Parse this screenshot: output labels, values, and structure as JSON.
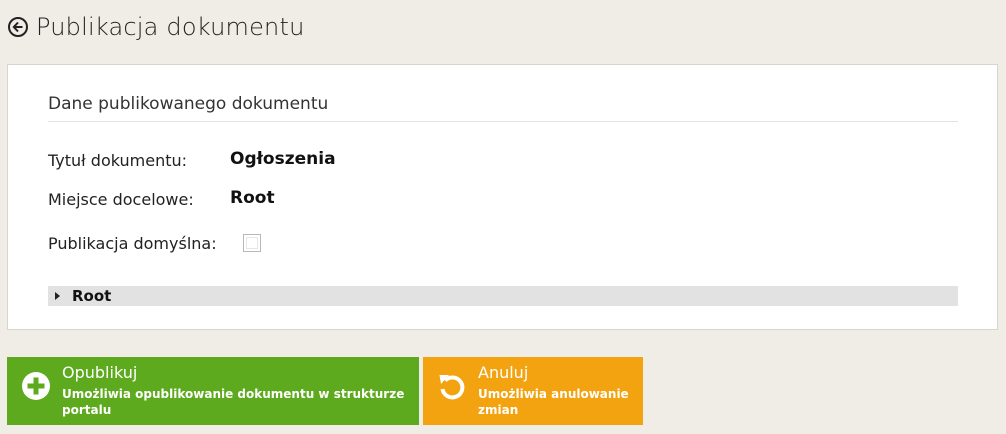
{
  "header": {
    "title": "Publikacja dokumentu",
    "back_icon": "arrow-left-circle-icon"
  },
  "panel": {
    "section_title": "Dane publikowanego dokumentu",
    "rows": [
      {
        "label": "Tytuł dokumentu:",
        "value": "Ogłoszenia"
      },
      {
        "label": "Miejsce docelowe:",
        "value": "Root"
      }
    ],
    "default_publication": {
      "label": "Publikacja domyślna:",
      "checked": false
    },
    "tree": {
      "root_label": "Root",
      "expanded": false
    }
  },
  "actions": {
    "publish": {
      "title": "Opublikuj",
      "description": "Umożliwia opublikowanie dokumentu w strukturze portalu",
      "icon": "plus-circle-icon",
      "color": "#5eaa1e"
    },
    "cancel": {
      "title": "Anuluj",
      "description": "Umożliwia anulowanie zmian",
      "icon": "undo-icon",
      "color": "#f2a30f"
    }
  },
  "colors": {
    "background": "#f0ece6",
    "panel": "#ffffff",
    "tree_row": "#e2e2e2"
  }
}
